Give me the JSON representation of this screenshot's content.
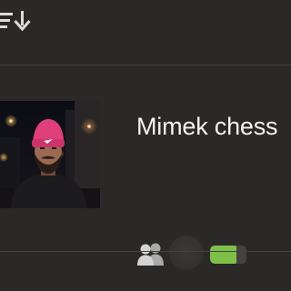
{
  "toolbar": {
    "sort_icon": "sort-descending-icon"
  },
  "card": {
    "title": "Mimek chess",
    "photo_icon": "profile-photo",
    "players_icon": "people-icon",
    "battery_level": 0.72,
    "battery_color": "#7fc04a"
  },
  "colors": {
    "background": "#2a2927",
    "divider": "#444240",
    "text": "#f5f5f5",
    "icon": "#dcdcdc"
  }
}
